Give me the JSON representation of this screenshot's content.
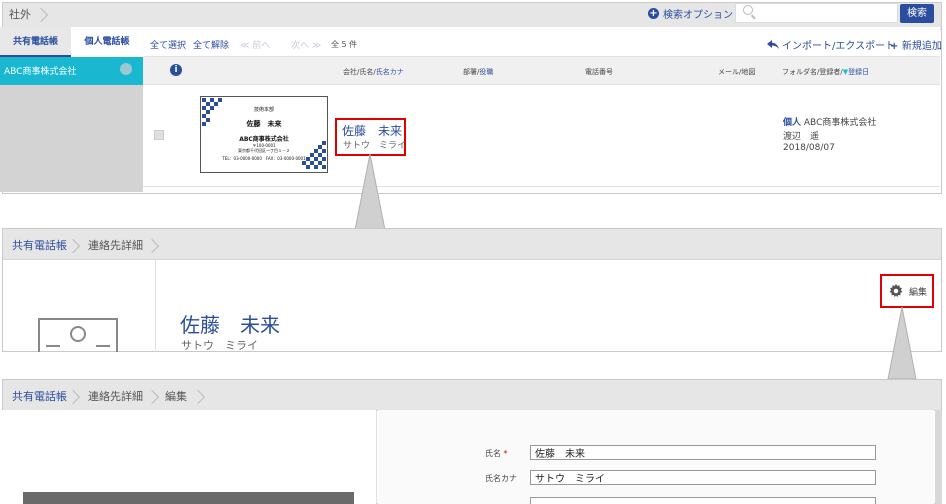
{
  "panel1": {
    "breadcrumb": "社外",
    "search_option": "検索オプション",
    "search_placeholder": "",
    "search_button": "検索",
    "tabs": [
      "共有電話帳",
      "個人電話帳"
    ],
    "sidebar_item": "ABC商事株式会社",
    "toolbar": {
      "select_all": "全て選択",
      "deselect_all": "全て解除",
      "prev": "≪ 前へ",
      "next": "次へ ≫",
      "total": "全 5 件",
      "import_export": "インポート/エクスポート",
      "add_new": "新規追加"
    },
    "columns": {
      "company": "会社/氏名/",
      "company_sort": "氏名カナ",
      "dept": "部署/",
      "dept_sort": "役職",
      "phone": "電話番号",
      "mail": "メール/地図",
      "folder": "フォルダ名/登録者/",
      "folder_sort": "登録日"
    },
    "row": {
      "name": "佐藤　未来",
      "kana": "サトウ　ミライ",
      "folder_tag": "個人",
      "company": "ABC商事株式会社",
      "registrar": "渡辺　遥",
      "date": "2018/08/07"
    },
    "card": {
      "dept": "技術本部",
      "name": "佐藤　未来",
      "company": "ABC商事株式会社",
      "zip": "〒100-0001",
      "addr": "東京都千代田区一丁目１－２",
      "tel": "TEL：03-0000-0000　FAX：03-0000-0001"
    }
  },
  "panel2": {
    "breadcrumbs": [
      "共有電話帳",
      "連絡先詳細"
    ],
    "name": "佐藤　未来",
    "kana": "サトウ　ミライ",
    "edit": "編集"
  },
  "panel3": {
    "breadcrumbs": [
      "共有電話帳",
      "連絡先詳細",
      "編集"
    ],
    "fields": [
      {
        "label": "氏名",
        "required": "*",
        "value": "佐藤　未来"
      },
      {
        "label": "氏名カナ",
        "required": "",
        "value": "サトウ　ミライ"
      }
    ]
  },
  "colors": {
    "accent": "#2a4d9e",
    "highlight": "#e00000",
    "sidebar_active": "#19b8d0"
  }
}
